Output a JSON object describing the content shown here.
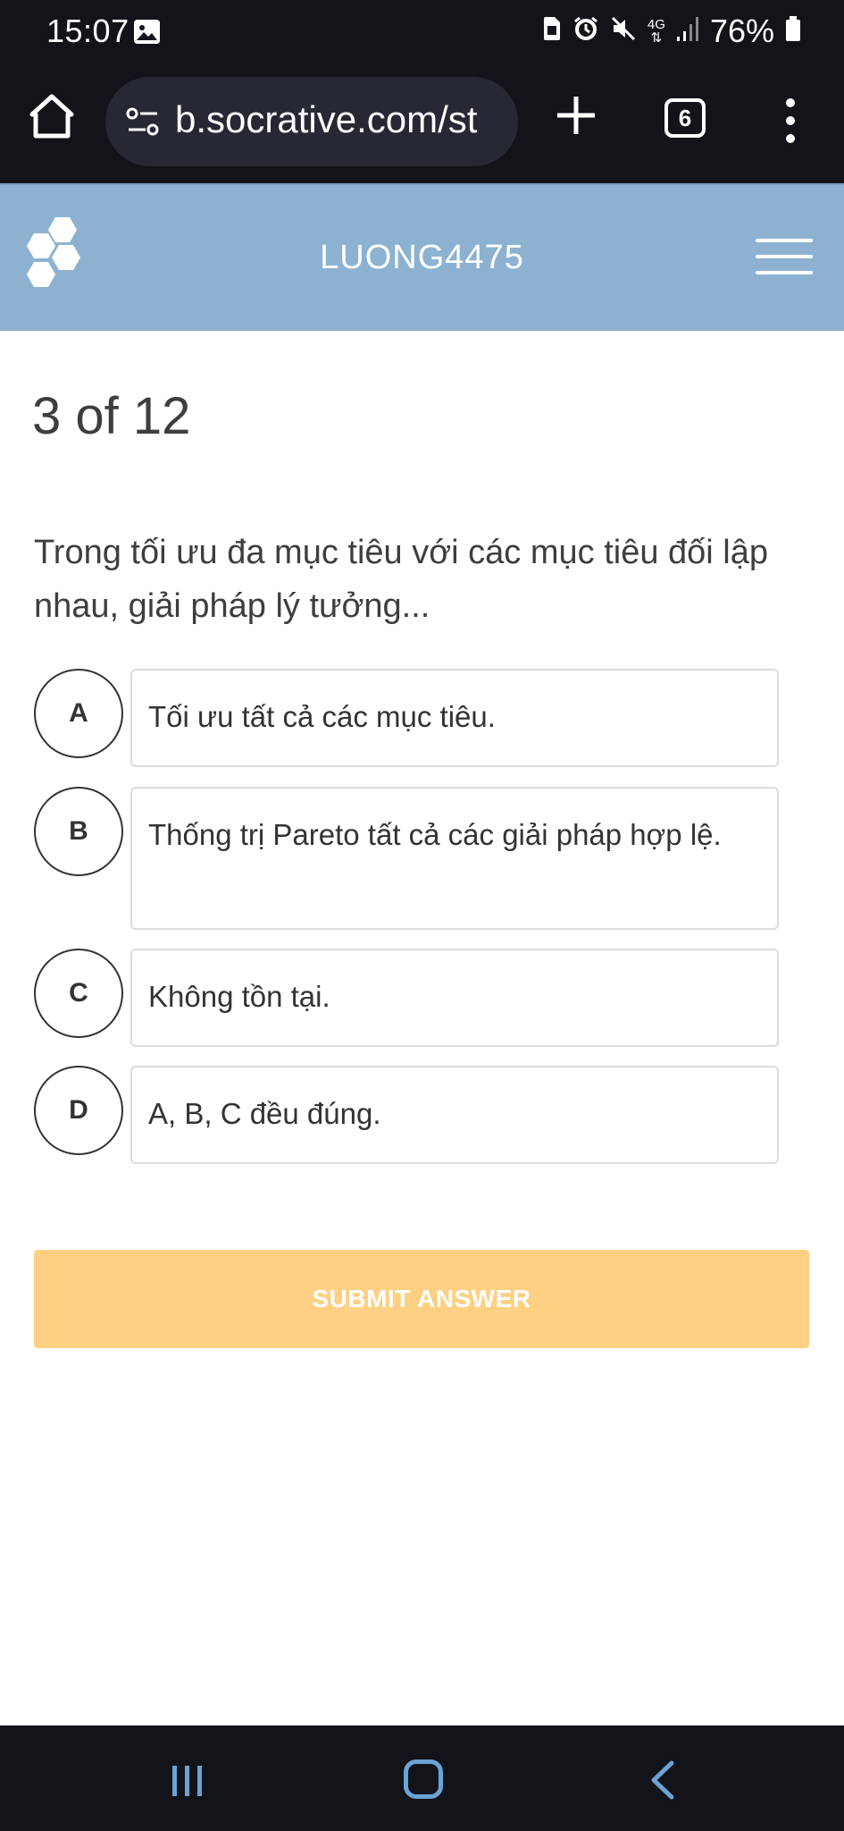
{
  "status_bar": {
    "time": "15:07",
    "network": "4G",
    "battery": "76%"
  },
  "browser": {
    "url": "b.socrative.com/st",
    "tab_count": "6"
  },
  "header": {
    "room_name": "LUONG4475"
  },
  "quiz": {
    "progress": "3 of 12",
    "question": "Trong tối ưu đa mục tiêu với các mục tiêu đối lập nhau, giải pháp lý tưởng...",
    "answers": [
      {
        "letter": "A",
        "text": "Tối ưu tất cả các mục tiêu."
      },
      {
        "letter": "B",
        "text": "Thống trị Pareto tất cả các giải pháp hợp lệ."
      },
      {
        "letter": "C",
        "text": "Không tồn tại."
      },
      {
        "letter": "D",
        "text": "A, B, C đều đúng."
      }
    ],
    "submit_label": "SUBMIT ANSWER"
  },
  "colors": {
    "header_bg": "#8db2d1",
    "submit_bg": "#fdd083",
    "system_bar_bg": "#13131a"
  }
}
